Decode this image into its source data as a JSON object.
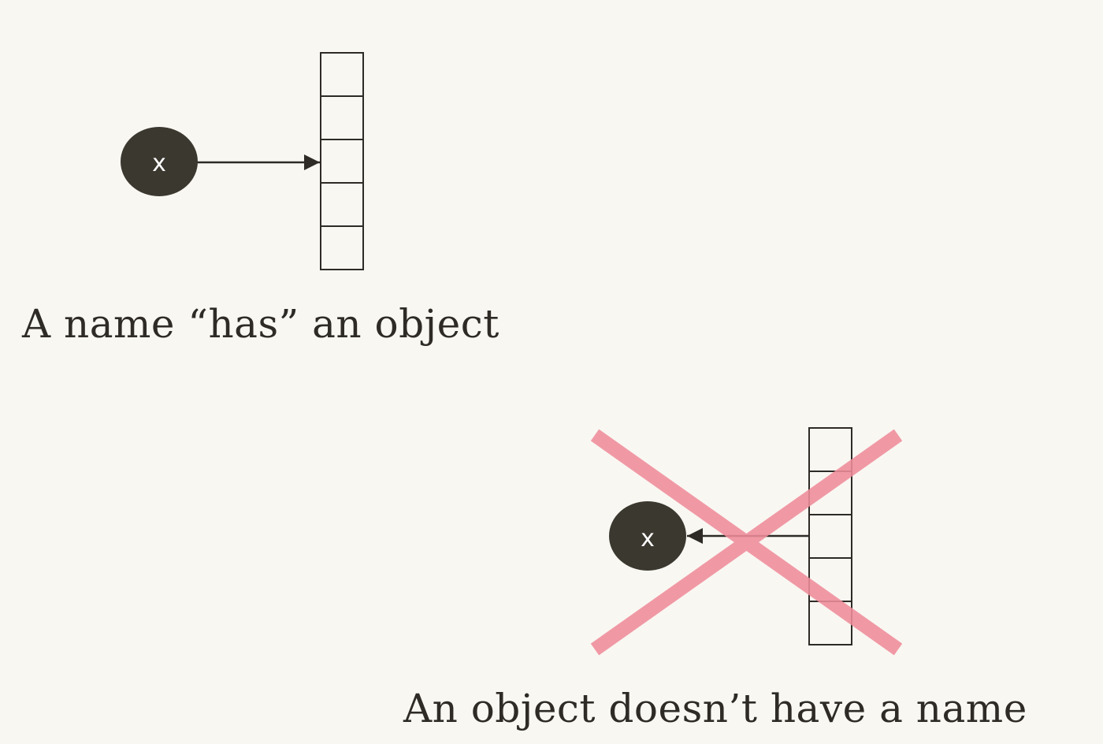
{
  "panels": {
    "correct": {
      "name_label": "x",
      "caption": "A name “has” an object",
      "array_cells": 5,
      "arrow_direction": "name-to-object"
    },
    "incorrect": {
      "name_label": "x",
      "caption": "An object doesn’t have a name",
      "array_cells": 5,
      "arrow_direction": "object-to-name",
      "crossed_out": true
    }
  },
  "colors": {
    "background": "#f9f7f2",
    "node_fill": "#3b3830",
    "node_text": "#ffffff",
    "ink": "#2e2b26",
    "cross": "#ef8d9b"
  }
}
